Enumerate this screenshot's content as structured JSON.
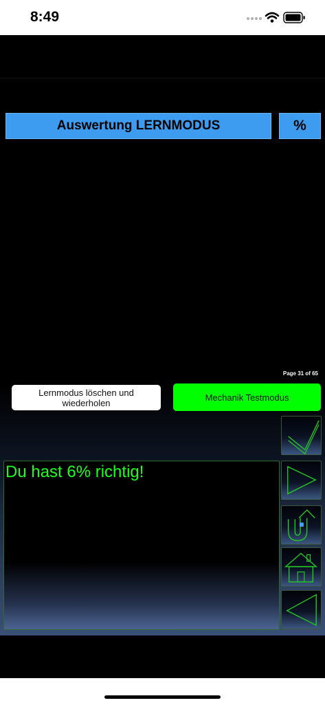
{
  "status_bar": {
    "time": "8:49"
  },
  "header": {
    "title": "Auswertung LERNMODUS",
    "percent_label": "%"
  },
  "page_indicator": "Page 31 of 65",
  "buttons": {
    "reset_label": "Lernmodus löschen und wiederholen",
    "test_label": "Mechanik Testmodus"
  },
  "result": {
    "text": "Du hast 6% richtig!"
  },
  "nav": {
    "items": [
      "check-icon",
      "play-icon",
      "undo-icon",
      "home-icon",
      "back-icon"
    ]
  },
  "colors": {
    "accent_blue": "#3d9cf0",
    "accent_green": "#00ff00",
    "result_text": "#1bff1b",
    "icon_stroke": "#22cc22"
  }
}
